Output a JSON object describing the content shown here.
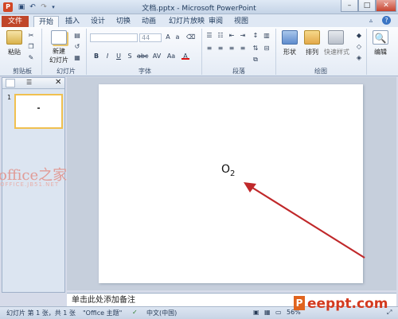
{
  "titlebar": {
    "title": "文档.pptx - Microsoft PowerPoint",
    "app_icon": "P"
  },
  "tabs": [
    "文件",
    "开始",
    "插入",
    "设计",
    "切换",
    "动画",
    "幻灯片放映",
    "审阅",
    "视图"
  ],
  "ribbon": {
    "groups": {
      "clipboard": "剪贴板",
      "slides": "幻灯片",
      "font": "字体",
      "paragraph": "段落",
      "drawing": "绘图"
    },
    "paste_label": "粘贴",
    "new_slide_label": "新建",
    "new_slide_label2": "幻灯片",
    "font_size": "44",
    "shapes_label": "形状",
    "arrange_label": "排列",
    "quick_styles_label": "快速样式",
    "edit_label": "编辑",
    "font_buttons": [
      "B",
      "I",
      "U",
      "S",
      "abc",
      "AV",
      "Aa",
      "A"
    ]
  },
  "left_panel": {
    "slide_number": "1"
  },
  "slide": {
    "formula_main": "O",
    "formula_sub": "2"
  },
  "notes_placeholder": "单击此处添加备注",
  "statusbar": {
    "slide_info": "幻灯片 第 1 张，共 1 张",
    "theme": "\"Office 主题\"",
    "language": "中文(中国)",
    "zoom": "56%"
  },
  "watermark": {
    "text": "office之家",
    "sub": "OFFICE.JB51.NET"
  },
  "site_logo": {
    "text": "eeppt.com",
    "icon": "P"
  },
  "colors": {
    "file_tab": "#c0462a",
    "arrow": "#c0282a",
    "accent": "#d33a1f"
  }
}
